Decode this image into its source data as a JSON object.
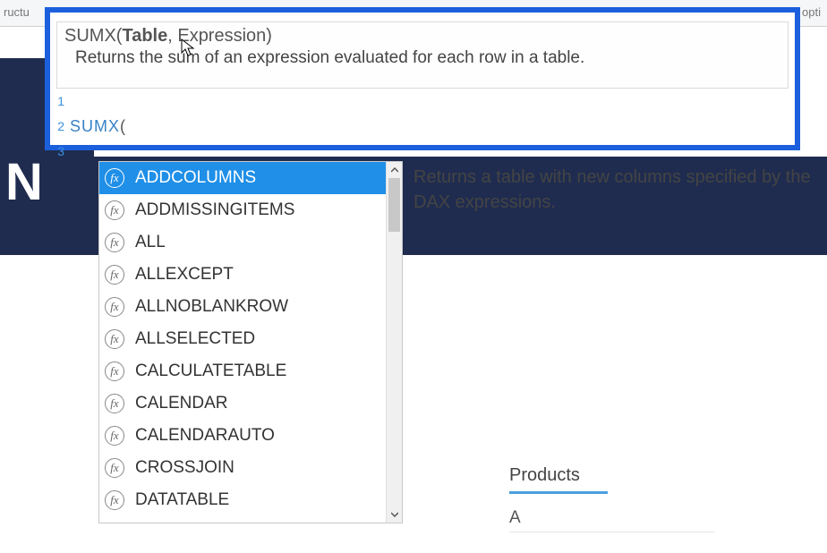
{
  "toolbar": {
    "left_fragment": "ructu",
    "right_fragment": "opti"
  },
  "tooltip": {
    "func_name": "SUMX",
    "open_paren": "(",
    "current_param": "Table",
    "rest_params": ", Expression)",
    "description": "Returns the sum of an expression evaluated for each row in a table."
  },
  "editor": {
    "lines": [
      {
        "num": "1",
        "content_type": "empty"
      },
      {
        "num": "2",
        "content_type": "code",
        "fn": "SUMX",
        "paren": "("
      },
      {
        "num": "3",
        "content_type": "empty"
      }
    ]
  },
  "autocomplete": {
    "items": [
      {
        "label": "ADDCOLUMNS",
        "selected": true
      },
      {
        "label": "ADDMISSINGITEMS",
        "selected": false
      },
      {
        "label": "ALL",
        "selected": false
      },
      {
        "label": "ALLEXCEPT",
        "selected": false
      },
      {
        "label": "ALLNOBLANKROW",
        "selected": false
      },
      {
        "label": "ALLSELECTED",
        "selected": false
      },
      {
        "label": "CALCULATETABLE",
        "selected": false
      },
      {
        "label": "CALENDAR",
        "selected": false
      },
      {
        "label": "CALENDARAUTO",
        "selected": false
      },
      {
        "label": "CROSSJOIN",
        "selected": false
      },
      {
        "label": "DATATABLE",
        "selected": false
      }
    ],
    "description": "Returns a table with new columns specified by the DAX expressions."
  },
  "products": {
    "title": "Products",
    "rows": [
      "A"
    ]
  },
  "dark_band_text": "N"
}
